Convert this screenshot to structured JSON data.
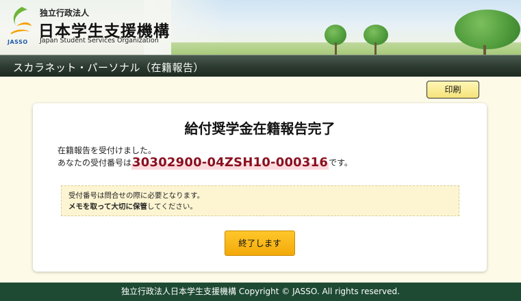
{
  "header": {
    "logo_text": "JASSO",
    "org_type": "独立行政法人",
    "org_name": "日本学生支援機構",
    "org_name_en": "Japan Student Services Organization"
  },
  "titlebar": {
    "title": "スカラネット・パーソナル（在籍報告）"
  },
  "toolbar": {
    "print_label": "印刷"
  },
  "main": {
    "heading": "給付奨学金在籍報告完了",
    "message_line1": "在籍報告を受付けました。",
    "message_prefix": "あなたの受付番号は",
    "receipt_number": "30302900-04ZSH10-000316",
    "message_suffix": "です。",
    "notice_line1": "受付番号は問合せの際に必要となります。",
    "notice_bold1": "メモを取って大切に保管",
    "notice_rest": "してください。",
    "finish_label": "終了します"
  },
  "footer": {
    "text": "独立行政法人日本学生支援機構 Copyright © JASSO. All rights reserved."
  },
  "colors": {
    "accent": "#f3a90a",
    "titlebar": "#2c3a30",
    "footer": "#1e4a33",
    "receipt_number": "#8a1020"
  },
  "icons": {
    "logo": "jasso-logo-icon"
  }
}
